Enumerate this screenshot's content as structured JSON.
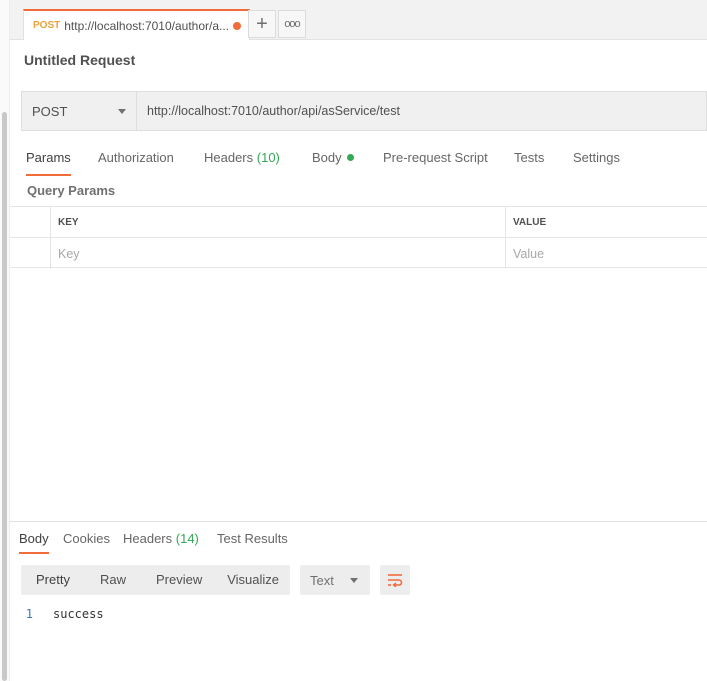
{
  "tab": {
    "method": "POST",
    "title": "http://localhost:7010/author/a..."
  },
  "tab_actions": {
    "add_symbol": "+",
    "more_symbol": "ooo"
  },
  "request": {
    "title": "Untitled Request",
    "method": "POST",
    "url": "http://localhost:7010/author/api/asService/test"
  },
  "request_tabs": {
    "params": "Params",
    "authorization": "Authorization",
    "headers": "Headers",
    "headers_count": "(10)",
    "body": "Body",
    "pre_request": "Pre-request Script",
    "tests": "Tests",
    "settings": "Settings"
  },
  "query_params": {
    "label": "Query Params",
    "key_header": "KEY",
    "value_header": "VALUE",
    "key_placeholder": "Key",
    "value_placeholder": "Value"
  },
  "response_tabs": {
    "body": "Body",
    "cookies": "Cookies",
    "headers": "Headers",
    "headers_count": "(14)",
    "test_results": "Test Results"
  },
  "response_toolbar": {
    "pretty": "Pretty",
    "raw": "Raw",
    "preview": "Preview",
    "visualize": "Visualize",
    "language": "Text"
  },
  "response_body": {
    "line_number": "1",
    "text": "success"
  },
  "colors": {
    "accent": "#f26b3a",
    "method_post": "#e8a33d",
    "count_green": "#34a853"
  },
  "icons": [
    "plus-icon",
    "more-icon",
    "chevron-down-icon",
    "wrap-lines-icon",
    "unsaved-dot-icon"
  ]
}
